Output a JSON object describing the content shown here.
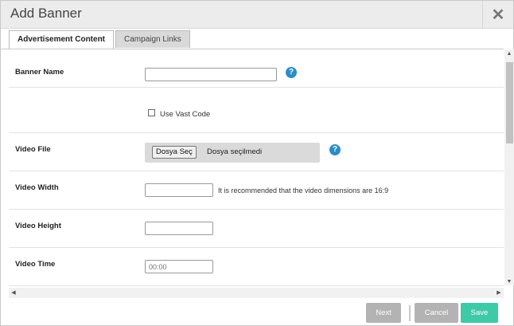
{
  "dialog": {
    "title": "Add Banner"
  },
  "tabs": [
    {
      "label": "Advertisement Content",
      "active": true
    },
    {
      "label": "Campaign Links",
      "active": false
    }
  ],
  "form": {
    "banner_name": {
      "label": "Banner Name",
      "value": ""
    },
    "use_vast_code": {
      "label": "Use Vast Code",
      "checked": false
    },
    "video_file": {
      "label": "Video File",
      "button": "Dosya Seç",
      "status": "Dosya seçilmedi"
    },
    "video_width": {
      "label": "Video Width",
      "value": "",
      "hint": "It is recommended that the video dimensions are 16:9"
    },
    "video_height": {
      "label": "Video Height",
      "value": ""
    },
    "video_time": {
      "label": "Video Time",
      "placeholder": "00:00"
    }
  },
  "help_glyph": "?",
  "footer": {
    "next": "Next",
    "cancel": "Cancel",
    "save": "Save"
  },
  "colors": {
    "help": "#2b8dc8",
    "save": "#3ec9a7",
    "disabled": "#b3b3b3"
  }
}
